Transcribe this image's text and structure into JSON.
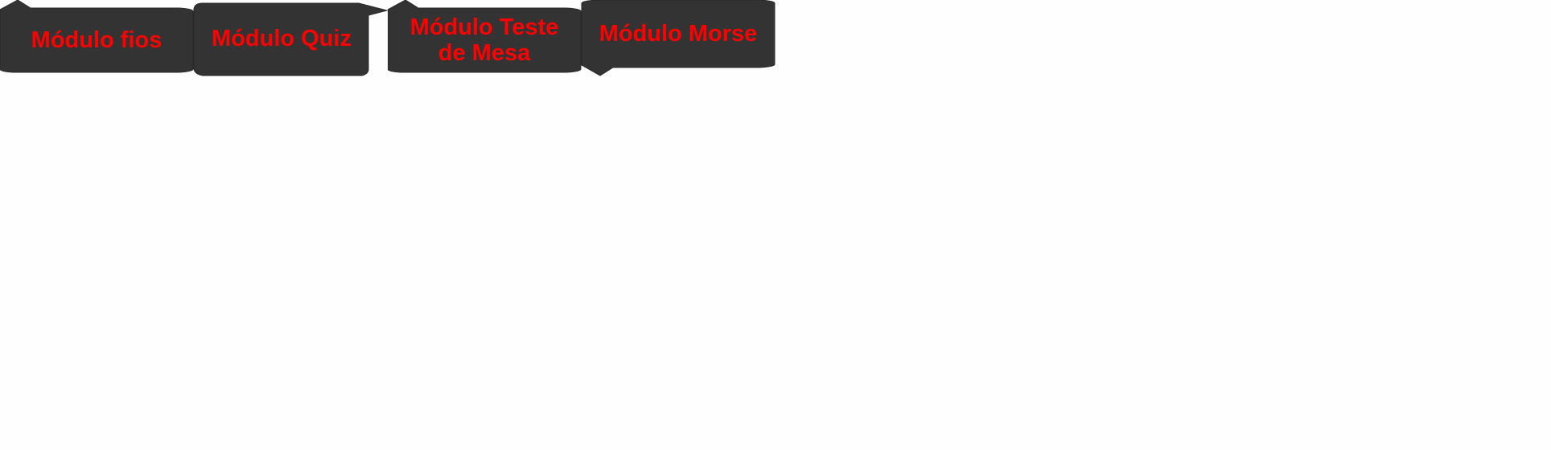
{
  "colors": {
    "background": "#fefefe",
    "panel": "#333333",
    "label": "#ff0000"
  },
  "modules": [
    {
      "label": "Módulo fios"
    },
    {
      "label": "Módulo Quiz"
    },
    {
      "label": "Módulo Teste\nde Mesa"
    },
    {
      "label": "Módulo Morse"
    }
  ]
}
